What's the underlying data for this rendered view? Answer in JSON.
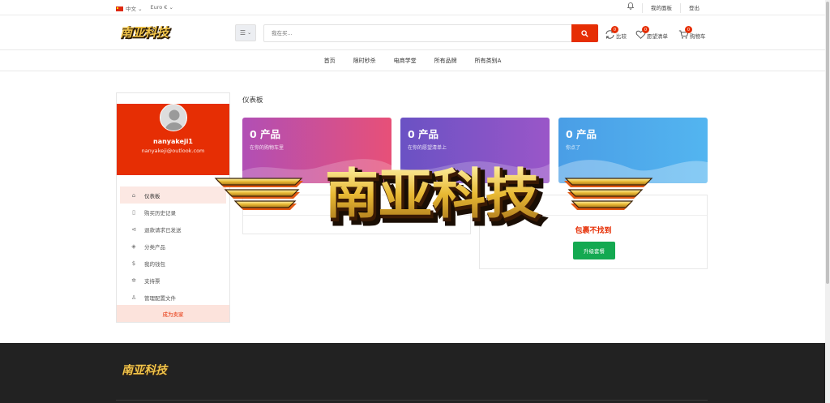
{
  "topbar": {
    "language": "中文",
    "currency": "Euro €",
    "dashboard_link": "我的面板",
    "logout_link": "登出"
  },
  "header": {
    "logo_text": "南亚科技",
    "search_placeholder": "我在买...",
    "compare": {
      "label": "比较",
      "count": "0"
    },
    "wishlist": {
      "label": "愿望清单",
      "count": "0"
    },
    "cart": {
      "label": "购物车",
      "count": "0"
    }
  },
  "nav": {
    "items": [
      "首页",
      "限时秒杀",
      "电商学堂",
      "所有品牌",
      "所有类别A"
    ]
  },
  "sidebar": {
    "username": "nanyakeji1",
    "email": "nanyakeji@outlook.com",
    "menu": [
      {
        "label": "仪表板",
        "icon": "home-icon"
      },
      {
        "label": "购买历史记录",
        "icon": "file-icon"
      },
      {
        "label": "退款请求已发送",
        "icon": "refund-icon"
      },
      {
        "label": "分类产品",
        "icon": "diamond-icon"
      },
      {
        "label": "我的钱包",
        "icon": "dollar-icon"
      },
      {
        "label": "支持票",
        "icon": "support-icon"
      },
      {
        "label": "管理配置文件",
        "icon": "user-icon"
      }
    ],
    "become_seller": "成为卖家"
  },
  "dashboard": {
    "title": "仪表板",
    "cards": [
      {
        "value": "0 产品",
        "subtitle": "在你的购物车里"
      },
      {
        "value": "0 产品",
        "subtitle": "在你的愿望清单上"
      },
      {
        "value": "0 产品",
        "subtitle": "你点了"
      }
    ],
    "package_not_found": "包裹不找到",
    "upgrade_button": "升级套餐"
  },
  "watermark_text": "南亚科技",
  "colors": {
    "accent": "#e62e04",
    "success": "#14a951",
    "footer_bg": "#222222"
  }
}
